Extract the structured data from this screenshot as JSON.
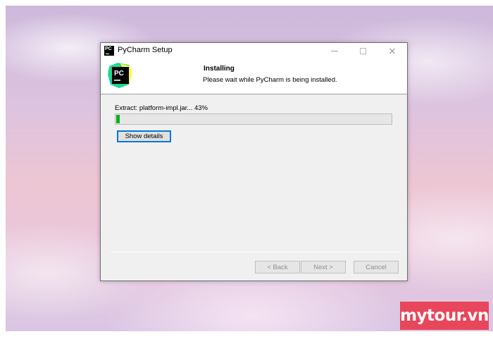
{
  "window": {
    "title": "PyCharm Setup",
    "controls": [
      "minimize-icon",
      "maximize-icon",
      "close-icon"
    ]
  },
  "header": {
    "logo_text": "PC",
    "title": "Installing",
    "subtitle": "Please wait while PyCharm is being installed."
  },
  "progress": {
    "status": "Extract: platform-impl.jar... 43%",
    "fraction": 0.43,
    "shown_fill_fraction": 0.012,
    "color": "#06b025"
  },
  "buttons": {
    "show_details": "Show details",
    "back": "< Back",
    "next": "Next >",
    "cancel": "Cancel"
  },
  "watermark": {
    "text": "mytour.vn",
    "color": "#e8465b"
  }
}
